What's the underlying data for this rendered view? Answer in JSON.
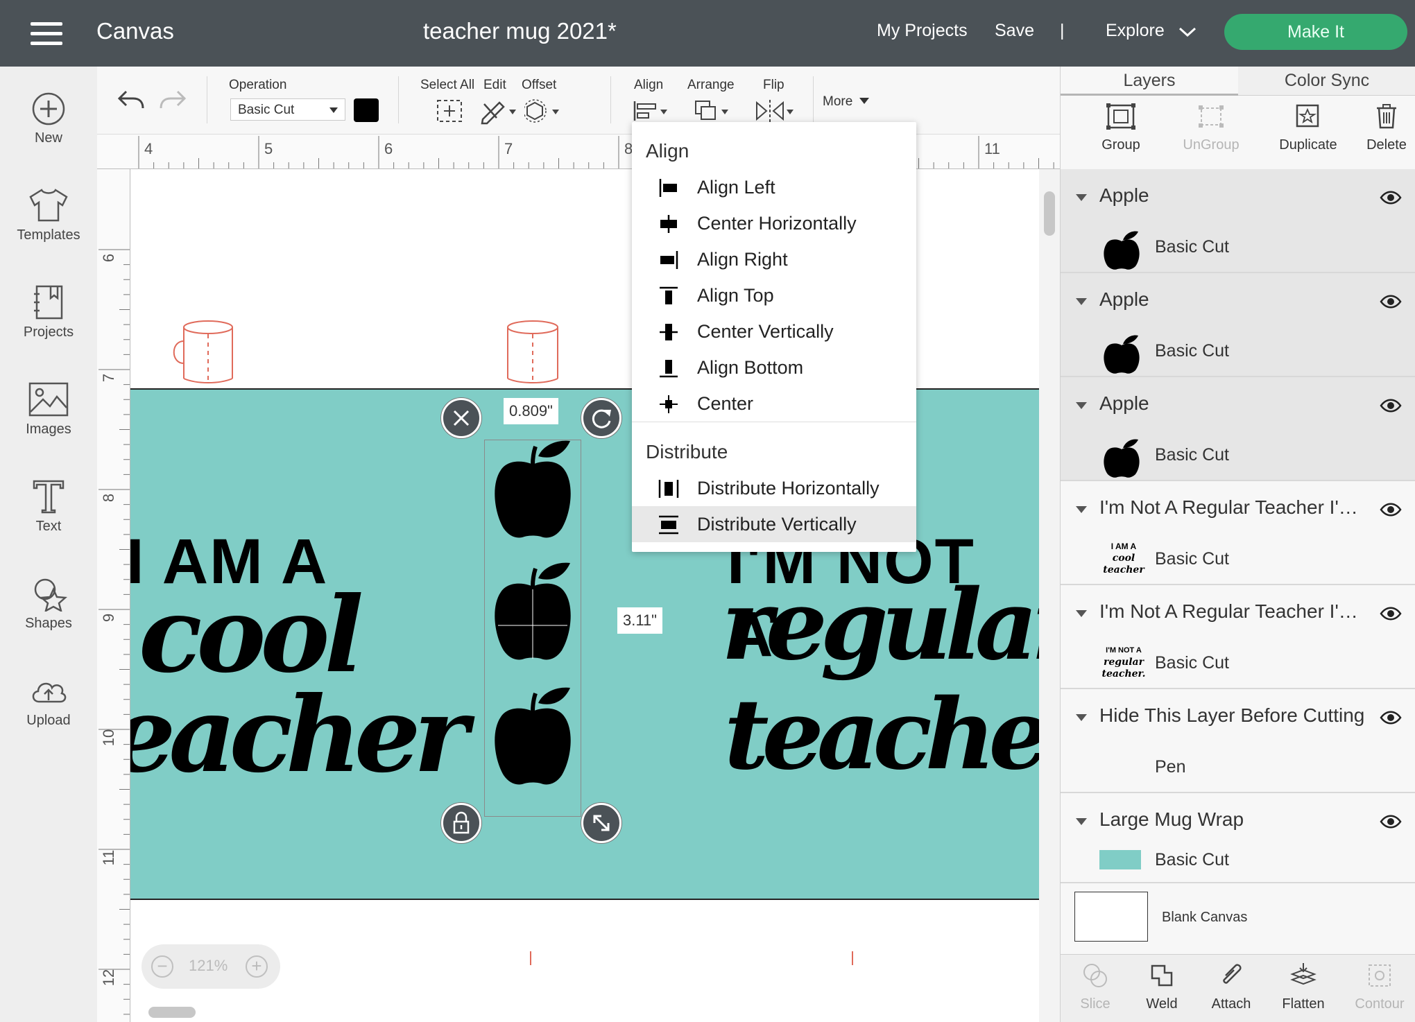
{
  "topbar": {
    "app_title": "Canvas",
    "doc_title": "teacher mug 2021*",
    "my_projects": "My Projects",
    "save": "Save",
    "divider": "|",
    "explore": "Explore",
    "make_it": "Make It"
  },
  "leftbar": {
    "items": [
      {
        "label": "New",
        "icon": "plus-circle-icon"
      },
      {
        "label": "Templates",
        "icon": "tshirt-icon"
      },
      {
        "label": "Projects",
        "icon": "notebook-icon"
      },
      {
        "label": "Images",
        "icon": "image-icon"
      },
      {
        "label": "Text",
        "icon": "text-icon"
      },
      {
        "label": "Shapes",
        "icon": "shapes-icon"
      },
      {
        "label": "Upload",
        "icon": "cloud-upload-icon"
      }
    ]
  },
  "toolbar": {
    "operation_label": "Operation",
    "operation_value": "Basic Cut",
    "color": "#000000",
    "select_all": "Select All",
    "edit": "Edit",
    "offset": "Offset",
    "align": "Align",
    "arrange": "Arrange",
    "flip": "Flip",
    "more": "More"
  },
  "rulers": {
    "top": [
      "4",
      "5",
      "6",
      "7",
      "8",
      "11"
    ],
    "left": [
      "6",
      "7",
      "8",
      "9",
      "10",
      "11",
      "12"
    ]
  },
  "canvas": {
    "mug_color": "#80cdc6",
    "left_text": {
      "line1": "I AM A",
      "line2": "cool",
      "line3": "eacher"
    },
    "right_text": {
      "line1": "I'M NOT A",
      "line2": "regular",
      "line3": "teacher."
    },
    "width_label": "0.809\"",
    "height_label": "3.11\"",
    "zoom": "121%"
  },
  "align_menu": {
    "align_heading": "Align",
    "align_items": [
      {
        "label": "Align Left",
        "icon": "align-left-icon"
      },
      {
        "label": "Center Horizontally",
        "icon": "center-horizontally-icon"
      },
      {
        "label": "Align Right",
        "icon": "align-right-icon"
      },
      {
        "label": "Align Top",
        "icon": "align-top-icon"
      },
      {
        "label": "Center Vertically",
        "icon": "center-vertically-icon"
      },
      {
        "label": "Align Bottom",
        "icon": "align-bottom-icon"
      },
      {
        "label": "Center",
        "icon": "center-icon"
      }
    ],
    "distribute_heading": "Distribute",
    "distribute_items": [
      {
        "label": "Distribute Horizontally",
        "icon": "distribute-horizontally-icon"
      },
      {
        "label": "Distribute Vertically",
        "icon": "distribute-vertically-icon",
        "active": true
      }
    ]
  },
  "rightpanel": {
    "tabs": [
      "Layers",
      "Color Sync"
    ],
    "actions": [
      {
        "label": "Group",
        "enabled": true
      },
      {
        "label": "UnGroup",
        "enabled": false
      },
      {
        "label": "Duplicate",
        "enabled": true
      },
      {
        "label": "Delete",
        "enabled": true
      }
    ],
    "layers": [
      {
        "name": "Apple",
        "operation": "Basic Cut",
        "thumb": "apple"
      },
      {
        "name": "Apple",
        "operation": "Basic Cut",
        "thumb": "apple"
      },
      {
        "name": "Apple",
        "operation": "Basic Cut",
        "thumb": "apple"
      },
      {
        "name": "I'm Not A Regular Teacher I'm A Cool Teacher",
        "operation": "Basic Cut",
        "thumb": "cool-teacher"
      },
      {
        "name": "I'm Not A Regular Teacher I'm A Cool Teacher",
        "operation": "Basic Cut",
        "thumb": "regular-teacher"
      },
      {
        "name": "Hide This Layer Before Cutting",
        "operation": "Pen",
        "thumb": "none"
      },
      {
        "name": "Large Mug Wrap",
        "operation": "Basic Cut",
        "thumb": "swatch"
      }
    ],
    "thumb_cool": [
      "I AM A",
      "cool",
      "teacher"
    ],
    "thumb_regular": [
      "I'M NOT A",
      "regular",
      "teacher."
    ],
    "blank_canvas": "Blank Canvas",
    "bottom_actions": [
      {
        "label": "Slice",
        "enabled": false
      },
      {
        "label": "Weld",
        "enabled": true
      },
      {
        "label": "Attach",
        "enabled": true
      },
      {
        "label": "Flatten",
        "enabled": true
      },
      {
        "label": "Contour",
        "enabled": false
      }
    ]
  }
}
